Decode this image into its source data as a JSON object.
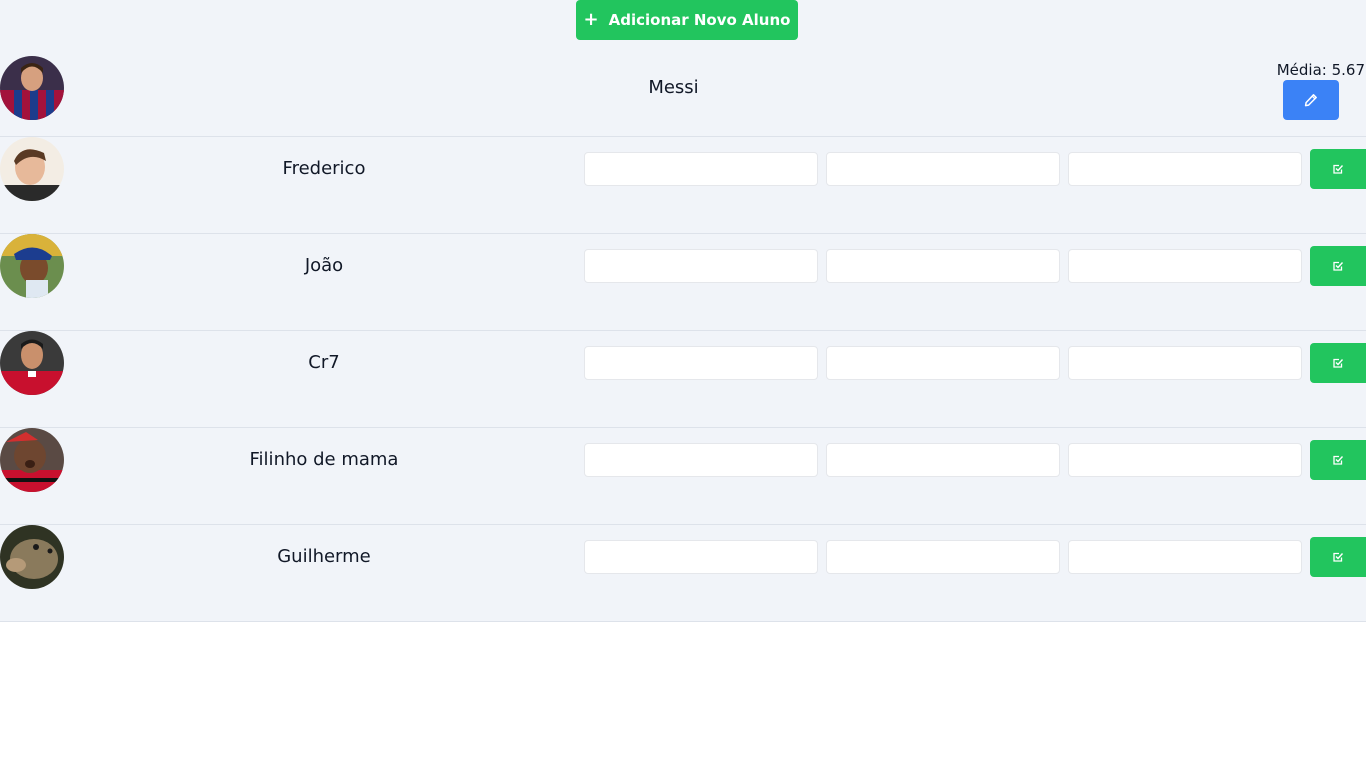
{
  "toolbar": {
    "add_label": "Adicionar Novo Aluno",
    "add_icon": "plus-icon"
  },
  "students": [
    {
      "name": "Messi",
      "status": "graded",
      "average_label": "Média: 5.67",
      "edit_icon": "pencil-icon",
      "avatar": "player-photo"
    },
    {
      "name": "Frederico",
      "status": "pending",
      "grades": [
        "",
        "",
        ""
      ],
      "submit_icon": "check-square-icon",
      "avatar": "person-photo"
    },
    {
      "name": "João",
      "status": "pending",
      "grades": [
        "",
        "",
        ""
      ],
      "submit_icon": "check-square-icon",
      "avatar": "person-photo"
    },
    {
      "name": "Cr7",
      "status": "pending",
      "grades": [
        "",
        "",
        ""
      ],
      "submit_icon": "check-square-icon",
      "avatar": "player-photo"
    },
    {
      "name": "Filinho de mama",
      "status": "pending",
      "grades": [
        "",
        "",
        ""
      ],
      "submit_icon": "check-square-icon",
      "avatar": "person-photo"
    },
    {
      "name": "Guilherme",
      "status": "pending",
      "grades": [
        "",
        "",
        ""
      ],
      "submit_icon": "check-square-icon",
      "avatar": "fish-photo"
    }
  ],
  "colors": {
    "primary_green": "#22c55e",
    "edit_blue": "#3b82f6",
    "list_background": "#f1f4f9",
    "row_divider": "#dde2ea"
  }
}
